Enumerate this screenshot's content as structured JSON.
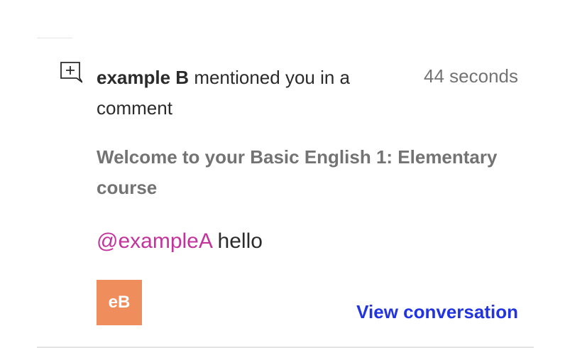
{
  "notification": {
    "actor": "example B",
    "action": "mentioned you in a comment",
    "time": "44 seconds",
    "course": "Welcome to your Basic English 1: Elementary course",
    "comment": {
      "mention": "@exampleA",
      "text": "hello"
    },
    "avatar": {
      "initials": "eB",
      "color": "#ef8d5d"
    },
    "link_label": "View conversation",
    "icon": "add-comment-icon"
  },
  "colors": {
    "mention": "#c2349c",
    "link": "#2234e2",
    "muted": "#737373",
    "text": "#2b2b2b"
  }
}
